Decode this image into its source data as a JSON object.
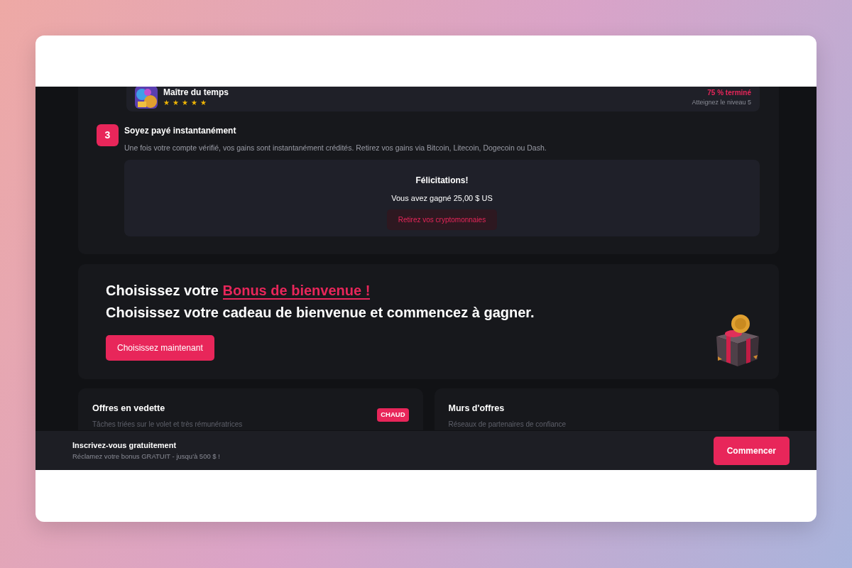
{
  "achievement": {
    "title": "Maître du temps",
    "stars": 5,
    "progress": "75 % terminé",
    "goal": "Atteignez le niveau 5"
  },
  "step": {
    "number": "3",
    "title": "Soyez payé instantanément",
    "description": "Une fois votre compte vérifié, vos gains sont instantanément crédités. Retirez vos gains via Bitcoin, Litecoin, Dogecoin ou Dash.",
    "result": {
      "title": "Félicitations!",
      "message": "Vous avez gagné 25,00 $ US",
      "button": "Retirez vos cryptomonnaies"
    }
  },
  "bonus": {
    "heading_prefix": "Choisissez votre",
    "heading_highlight": "Bonus de bienvenue !",
    "subheading": "Choisissez votre cadeau de bienvenue et commencez à gagner.",
    "button": "Choisissez maintenant"
  },
  "offers": [
    {
      "title": "Offres en vedette",
      "subtitle": "Tâches triées sur le volet et très rémunératrices",
      "badge": "CHAUD"
    },
    {
      "title": "Murs d'offres",
      "subtitle": "Réseaux de partenaires de confiance"
    }
  ],
  "signup_bar": {
    "title": "Inscrivez-vous gratuitement",
    "subtitle": "Réclamez votre bonus GRATUIT - jusqu'à 500 $ !",
    "button": "Commencer"
  }
}
